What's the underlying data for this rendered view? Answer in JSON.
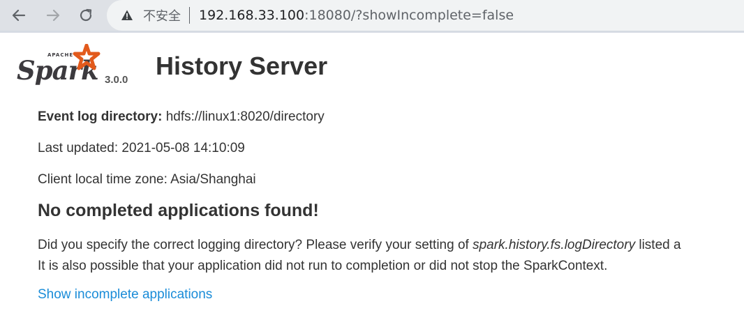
{
  "browser": {
    "security_label": "不安全",
    "url_host": "192.168.33.100",
    "url_rest": ":18080/?showIncomplete=false",
    "icons": {
      "back": "back-arrow-icon",
      "forward": "forward-arrow-icon",
      "reload": "reload-icon",
      "warning": "warning-triangle-icon"
    }
  },
  "header": {
    "logo_word": "Spark",
    "logo_apache": "APACHE",
    "version": "3.0.0",
    "title": "History Server"
  },
  "info": {
    "event_log_label": "Event log directory:",
    "event_log_value": " hdfs://linux1:8020/directory",
    "last_updated": "Last updated: 2021-05-08 14:10:09",
    "timezone": "Client local time zone: Asia/Shanghai"
  },
  "message": {
    "heading": "No completed applications found!",
    "line1_before": "Did you specify the correct logging directory? Please verify your setting of ",
    "line1_config": "spark.history.fs.logDirectory",
    "line1_after": " listed a",
    "line2": "It is also possible that your application did not run to completion or did not stop the SparkContext."
  },
  "link": {
    "show_incomplete": "Show incomplete applications"
  },
  "colors": {
    "link": "#1a8cd8",
    "spark_orange": "#e25a1c",
    "text": "#333333"
  }
}
